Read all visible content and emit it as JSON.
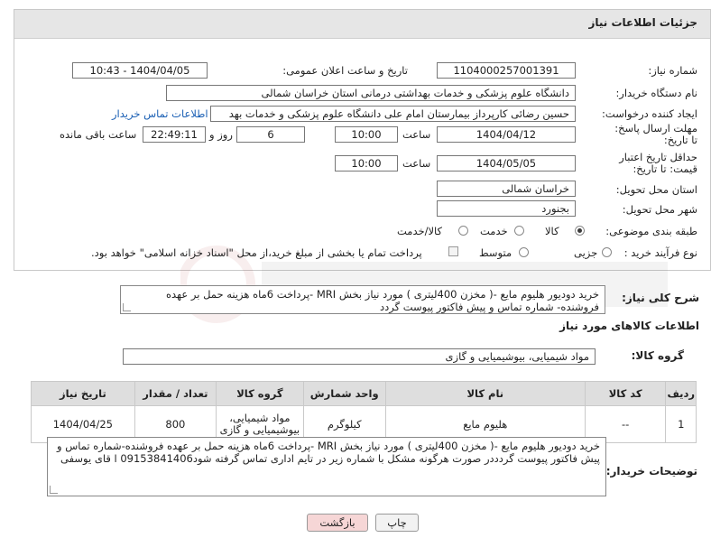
{
  "header": {
    "title": "جزئیات اطلاعات نیاز"
  },
  "fields": {
    "need_number_label": "شماره نیاز:",
    "need_number": "1104000257001391",
    "announce_label": "تاریخ و ساعت اعلان عمومی:",
    "announce_value": "1404/04/05 - 10:43",
    "buyer_org_label": "نام دستگاه خریدار:",
    "buyer_org": "دانشگاه علوم پزشکی و خدمات بهداشتی درمانی استان خراسان شمالی",
    "requester_label": "ایجاد کننده درخواست:",
    "requester": "حسین رضائی کارپرداز بیمارستان امام علی دانشگاه علوم پزشکی و خدمات بهد",
    "buyer_contact_link": "اطلاعات تماس خریدار",
    "deadline_label": "مهلت ارسال پاسخ: تا تاریخ:",
    "deadline_date": "1404/04/12",
    "time_label": "ساعت",
    "deadline_time": "10:00",
    "days_value": "6",
    "days_label": "روز و",
    "remaining_time": "22:49:11",
    "remaining_label": "ساعت باقی مانده",
    "price_validity_label": "حداقل تاریخ اعتبار قیمت: تا تاریخ:",
    "price_validity_date": "1404/05/05",
    "price_validity_time": "10:00",
    "province_label": "استان محل تحویل:",
    "province": "خراسان شمالی",
    "city_label": "شهر محل تحویل:",
    "city": "بجنورد",
    "category_label": "طبقه بندی موضوعی:",
    "category_options": [
      "کالا",
      "خدمت",
      "کالا/خدمت"
    ],
    "process_label": "نوع فرآیند خرید :",
    "process_options": [
      "جزیی",
      "متوسط"
    ],
    "payment_note": "پرداخت تمام یا بخشی از مبلغ خرید،از محل \"اسناد خزانه اسلامی\" خواهد بود."
  },
  "description": {
    "label": "شرح کلی نیاز:",
    "text": "خرید دودیور  هلیوم  مایع -( مخزن 400لیتری )  مورد نیاز بخش MRI -پرداخت 6ماه هزینه حمل بر عهده فروشنده-  شماره تماس و پیش فاکتور پیوست گردد"
  },
  "goods": {
    "section_title": "اطلاعات کالاهای مورد نیاز",
    "group_label": "گروه کالا:",
    "group_value": "مواد شیمیایی، بیوشیمیایی و  گازی",
    "columns": [
      "ردیف",
      "کد کالا",
      "نام کالا",
      "واحد شمارش",
      "گروه کالا",
      "تعداد / مقدار",
      "تاریخ نیاز"
    ],
    "rows": [
      {
        "row": "1",
        "code": "--",
        "name": "هلیوم مایع",
        "unit": "کیلوگرم",
        "group_line1": "مواد شیمیایی،",
        "group_line2": "بیوشیمیایی و گازی",
        "qty": "800",
        "date": "1404/04/25"
      }
    ]
  },
  "buyer_notes": {
    "label": "توضیحات خریدار:",
    "text": "خرید دودیور  هلیوم  مایع -( مخزن 400لیتری )  مورد نیاز بخش MRI -پرداخت 6ماه هزینه حمل بر عهده فروشنده-شماره تماس و پیش فاکتور پیوست گردددر صورت هرگونه مشکل با شماره زیر در تایم اداری تماس گرفته شود09153841406 ا قای یوسفی"
  },
  "buttons": {
    "print": "چاپ",
    "back": "بازگشت"
  },
  "colors": {
    "back_button_bg": "#f6d6d6",
    "print_button_bg": "#f2f2f2",
    "header_bg": "#e6e6e6",
    "link": "#1a5fb4"
  }
}
